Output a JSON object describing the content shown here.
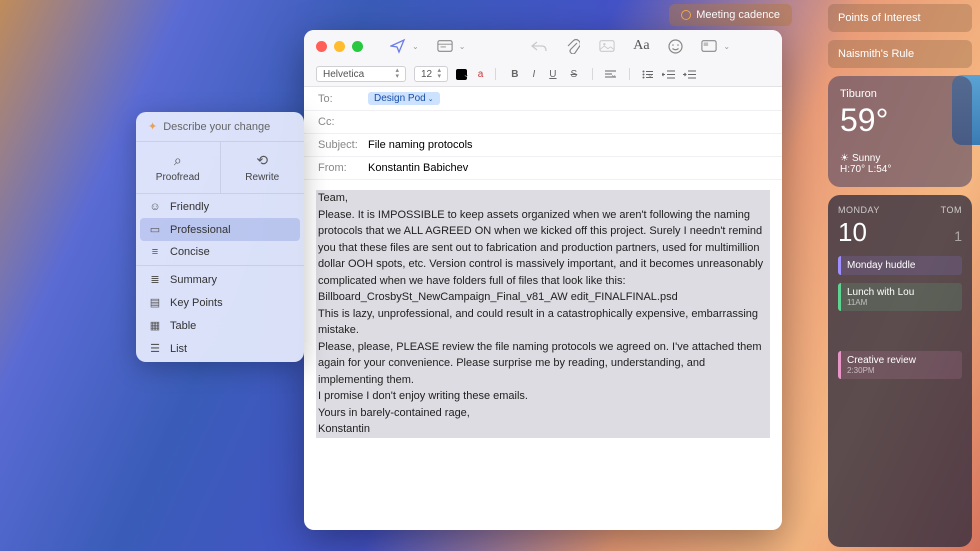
{
  "meeting_tag": "Meeting cadence",
  "sidebar": {
    "items": [
      "Points of Interest",
      "Naismith's Rule"
    ]
  },
  "weather": {
    "location": "Tiburon",
    "temp": "59°",
    "condition": "Sunny",
    "hilo": "H:70° L:54°"
  },
  "calendar": {
    "day_label": "MONDAY",
    "tom_label": "TOM",
    "today": "10",
    "tom": "1",
    "events": [
      {
        "title": "Monday huddle",
        "time": ""
      },
      {
        "title": "Lunch with Lou",
        "time": "11AM"
      },
      {
        "title": "Creative review",
        "time": "2:30PM"
      }
    ]
  },
  "compose": {
    "font_name": "Helvetica",
    "font_size": "12",
    "to_label": "To:",
    "to_value": "Design Pod",
    "cc_label": "Cc:",
    "cc_value": "",
    "subject_label": "Subject:",
    "subject_value": "File naming protocols",
    "from_label": "From:",
    "from_value": "Konstantin Babichev",
    "body": {
      "greeting": "Team,",
      "p1": "Please. It is IMPOSSIBLE to keep assets organized when we aren't following the naming protocols that we ALL AGREED ON when we kicked off this project. Surely I needn't remind you that these files are sent out to fabrication and production partners, used for multimillion dollar OOH spots, etc. Version control is massively important, and it becomes unreasonably complicated when we have folders full of files that look like this:",
      "p2": "Billboard_CrosbySt_NewCampaign_Final_v81_AW edit_FINALFINAL.psd",
      "p3": "This is lazy, unprofessional, and could result in a catastrophically expensive, embarrassing mistake.",
      "p4": "Please, please, PLEASE review the file naming protocols we agreed on. I've attached them again for your convenience. Please surprise me by reading, understanding, and implementing them.",
      "p5": "I promise I don't enjoy writing these emails.",
      "sign1": "Yours in barely-contained rage,",
      "sign2": "Konstantin"
    }
  },
  "ai": {
    "head": "Describe your change",
    "proofread": "Proofread",
    "rewrite": "Rewrite",
    "tones": [
      "Friendly",
      "Professional",
      "Concise"
    ],
    "formats": [
      "Summary",
      "Key Points",
      "Table",
      "List"
    ]
  }
}
